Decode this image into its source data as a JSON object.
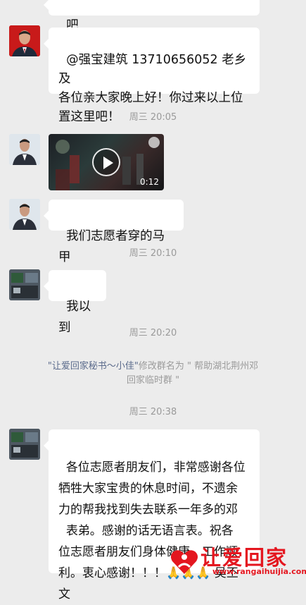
{
  "messages": {
    "partial_top": "吧",
    "greeting": "@强宝建筑 13710656052 老乡及\n各位亲大家晚上好！你过来以上位\n置这里吧！",
    "time1": "周三 20:05",
    "video_duration": "0:12",
    "volunteer_vest": "我们志愿者穿的马甲",
    "time2": "周三 20:10",
    "arrived": "我以到",
    "time3": "周三 20:20",
    "sys_name": "\"让爱回家秘书～小佳\"",
    "sys_text": "修改群名为 \" 帮助湖北荆州邓",
    "sys_text2": "回家临时群 \"",
    "time4": "周三 20:38",
    "thanks": "各位志愿者朋友们，非常感谢各位\n牺牲大家宝贵的休息时间，不遗余\n力的帮我找到失去联系一年多的邓\n  表弟。感谢的话无语言表。祝各\n位志愿者朋友们身体健康。工作顺\n利。衷心感谢！！！🙏🙏🙏 吴丕\n文"
  },
  "watermark": {
    "text": "让爱回家",
    "url": "www.rangaihuijia.com"
  },
  "colors": {
    "background": "#ececec",
    "bubble": "#ffffff",
    "timestamp": "#9a9a9a",
    "watermark": "#e4161f"
  }
}
